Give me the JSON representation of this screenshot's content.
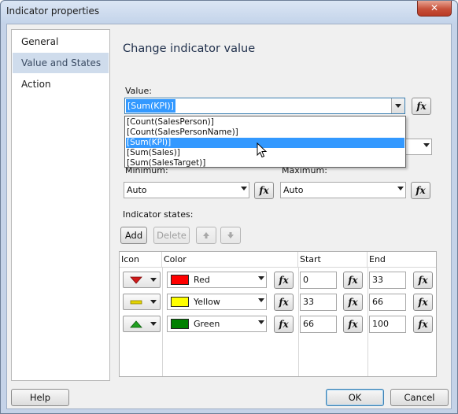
{
  "window": {
    "title": "Indicator properties",
    "close_glyph": "✕"
  },
  "nav": {
    "items": [
      {
        "label": "General"
      },
      {
        "label": "Value and States"
      },
      {
        "label": "Action"
      }
    ],
    "selected": "Value and States"
  },
  "main": {
    "heading": "Change indicator value",
    "value": {
      "label": "Value:",
      "current": "[Sum(KPI)]",
      "options": [
        "[Count(SalesPerson)]",
        "[Count(SalesPersonName)]",
        "[Sum(KPI)]",
        "[Sum(Sales)]",
        "[Sum(SalesTarget)]"
      ],
      "selected_index": 2
    },
    "minimum": {
      "label": "Minimum:",
      "value": "Auto"
    },
    "maximum": {
      "label": "Maximum:",
      "value": "Auto"
    },
    "states_label": "Indicator states:",
    "buttons": {
      "add": "Add",
      "delete": "Delete"
    },
    "fx_label": "fx",
    "table": {
      "headers": [
        "Icon",
        "Color",
        "Start",
        "End"
      ],
      "rows": [
        {
          "icon": "triangle-down-red-icon",
          "color_name": "Red",
          "color_hex": "#ff0000",
          "start": "0",
          "end": "33"
        },
        {
          "icon": "dash-yellow-icon",
          "color_name": "Yellow",
          "color_hex": "#ffff00",
          "start": "33",
          "end": "66"
        },
        {
          "icon": "triangle-up-green-icon",
          "color_name": "Green",
          "color_hex": "#008000",
          "start": "66",
          "end": "100"
        }
      ]
    }
  },
  "footer": {
    "help": "Help",
    "ok": "OK",
    "cancel": "Cancel"
  }
}
